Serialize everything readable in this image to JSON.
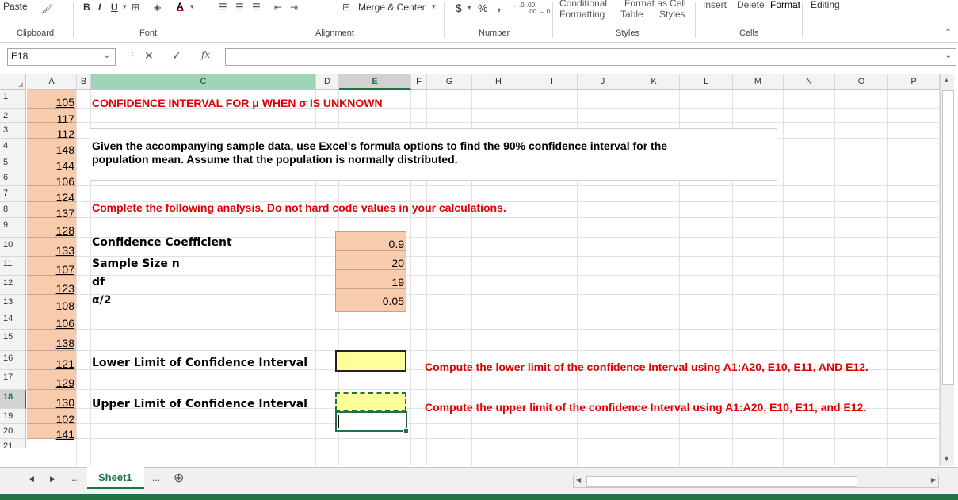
{
  "ribbon": {
    "paste": "Paste",
    "bold": "B",
    "italic": "I",
    "underline": "U",
    "merge_center": "Merge & Center",
    "currency": "$",
    "percent": "%",
    "comma": ",",
    "inc_decimal": "←.0 .00",
    "dec_decimal": ".00 →.0",
    "conditional_formatting_1": "Conditional",
    "conditional_formatting_2": "Formatting",
    "format_as_table_1": "Format as",
    "format_as_table_2": "Table",
    "cell_styles_1": "Cell",
    "cell_styles_2": "Styles",
    "insert": "Insert",
    "delete": "Delete",
    "format": "Format",
    "editing": "Editing",
    "groups": {
      "clipboard": "Clipboard",
      "font": "Font",
      "alignment": "Alignment",
      "number": "Number",
      "styles": "Styles",
      "cells": "Cells"
    }
  },
  "formula_bar": {
    "name_box": "E18",
    "formula": "",
    "fx": "fx"
  },
  "columns": [
    "A",
    "B",
    "C",
    "D",
    "E",
    "F",
    "G",
    "H",
    "I",
    "J",
    "K",
    "L",
    "M",
    "N",
    "O",
    "P"
  ],
  "rows": [
    "1",
    "2",
    "3",
    "4",
    "5",
    "6",
    "7",
    "8",
    "9",
    "10",
    "11",
    "12",
    "13",
    "14",
    "15",
    "16",
    "17",
    "18",
    "19",
    "20",
    "21"
  ],
  "sample_data": [
    105,
    117,
    112,
    148,
    144,
    106,
    124,
    137,
    128,
    133,
    107,
    123,
    108,
    106,
    138,
    121,
    129,
    130,
    102,
    141
  ],
  "title": "CONFIDENCE INTERVAL FOR μ WHEN σ IS UNKNOWN",
  "description_line1": "Given the accompanying sample data, use Excel's formula options to find the 90% confidence interval for the",
  "description_line2": "population mean. Assume that the population is normally distributed.",
  "instruction": "Complete the following analysis. Do not hard code values in your calculations.",
  "labels": {
    "confidence": "Confidence Coefficient",
    "sample_size": "Sample Size n",
    "df": "df",
    "alpha_half": "α/2",
    "lower": "Lower Limit of Confidence Interval",
    "upper": "Upper Limit of Confidence Interval"
  },
  "values": {
    "confidence": "0.9",
    "sample_size": "20",
    "df": "19",
    "alpha_half": "0.05"
  },
  "notes": {
    "lower": "Compute the lower limit of the confidence Interval using A1:A20, E10, E11, AND E12.",
    "upper": "Compute the upper limit of the confidence Interval using A1:A20, E10, E11, and E12."
  },
  "sheet_tabs": {
    "ellipsis_left": "...",
    "active": "Sheet1",
    "ellipsis_right": "...",
    "add": "⊕"
  },
  "colors": {
    "accent": "#217346",
    "orange_cell": "#f8cbad",
    "yellow_cell": "#ffff99",
    "red_text": "#e00000"
  }
}
